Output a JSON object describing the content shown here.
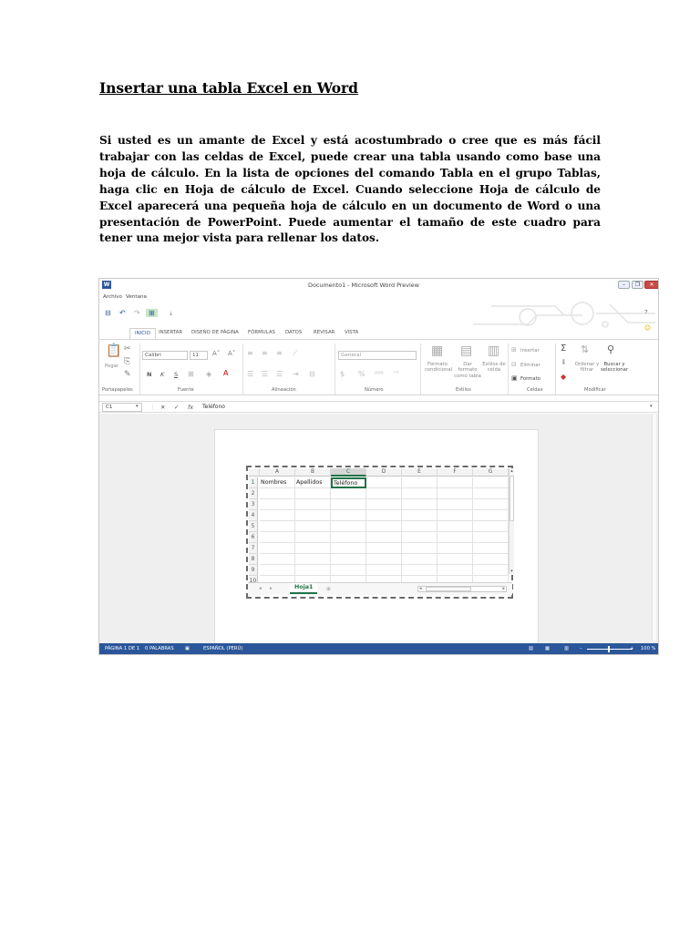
{
  "document": {
    "title": "Insertar una tabla Excel en Word",
    "paragraph": "Si usted es un amante de Excel y está acostumbrado o cree que es más fácil trabajar con las celdas de Excel, puede crear una tabla usando como base una hoja de cálculo. En la lista de opciones del comando Tabla en el grupo Tablas, haga clic en Hoja de cálculo de Excel. Cuando seleccione Hoja de cálculo de Excel aparecerá una pequeña hoja de cálculo en un documento de Word o una presentación de PowerPoint. Puede aumentar el tamaño de este cuadro para tener una mejor vista para rellenar los datos."
  },
  "screenshot": {
    "window_title": "Documento1 - Microsoft Word Preview",
    "menu": [
      "Archivo",
      "Ventana"
    ],
    "tabs": [
      "INICIO",
      "INSERTAR",
      "DISEÑO DE PÁGINA",
      "FÓRMULAS",
      "DATOS",
      "REVISAR",
      "VISTA"
    ],
    "ribbon": {
      "paste": "Pegar",
      "font_name": "Calibri",
      "font_size": "11",
      "bold": "N",
      "italic": "K",
      "underline": "S",
      "number_format": "General",
      "cond_format": "Formato condicional",
      "table_format": "Dar formato como tabla",
      "cell_styles": "Estilos de celda",
      "insert": "Insertar",
      "delete": "Eliminar",
      "format": "Formato",
      "sort_filter": "Ordenar y filtrar",
      "find_select": "Buscar y seleccionar",
      "groups": [
        "Portapapeles",
        "Fuente",
        "Alineación",
        "Número",
        "Estilos",
        "Celdas",
        "Modificar"
      ]
    },
    "formula_bar": {
      "cell_ref": "C1",
      "content": "Teléfono"
    },
    "sheet": {
      "columns": [
        "A",
        "B",
        "C",
        "D",
        "E",
        "F",
        "G"
      ],
      "rows": [
        "1",
        "2",
        "3",
        "4",
        "5",
        "6",
        "7",
        "8",
        "9",
        "10"
      ],
      "cells_row1": [
        "Nombres",
        "Apellidos",
        "Teléfono"
      ],
      "tab_name": "Hoja1"
    },
    "status_bar": {
      "page": "PÁGINA 1 DE 1",
      "words": "0 PALABRAS",
      "language": "ESPAÑOL (PERÚ)",
      "zoom": "100 %"
    }
  }
}
